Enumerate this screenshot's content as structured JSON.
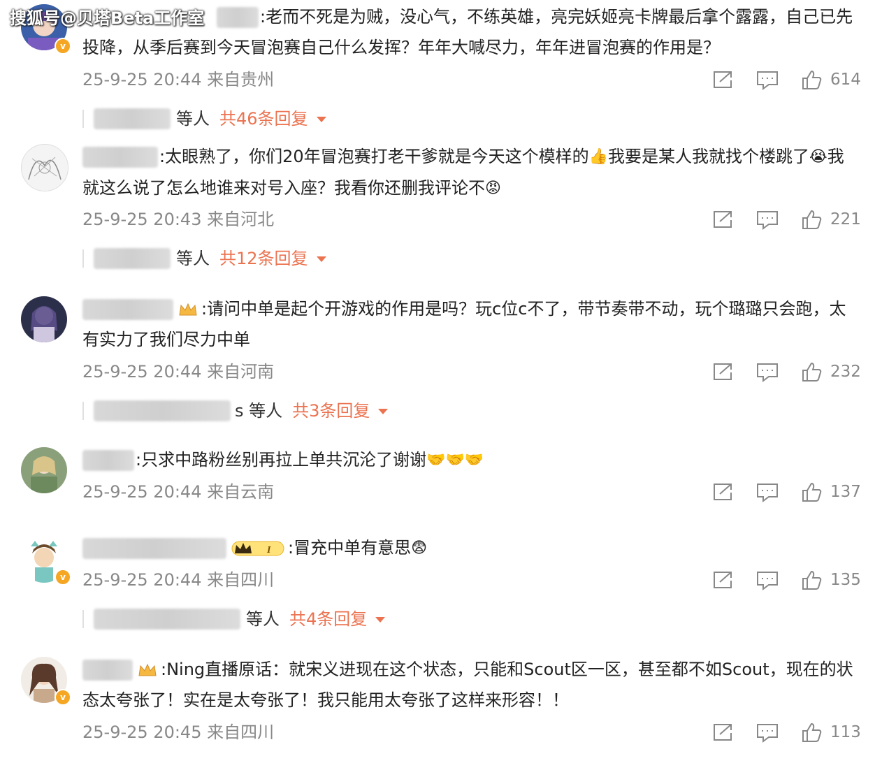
{
  "watermark": "搜狐号@贝塔Beta工作室",
  "colors": {
    "reply_accent": "#eb7350",
    "meta": "#888888",
    "badge": "#f5a623"
  },
  "icons": {
    "share": "share-icon",
    "comment": "comment-icon",
    "like": "like-icon"
  },
  "comments": [
    {
      "text": ":老而不死是为贼，没心气，不练英雄，亮完妖姬亮卡牌最后拿个露露，自己已先投降，从季后赛到今天冒泡赛自己什么发挥？年年大喊尽力，年年进冒泡赛的作用是？",
      "time": "25-9-25 20:44",
      "location": "来自贵州",
      "likes": "614",
      "replies": {
        "who": "等人",
        "count": "共46条回复"
      }
    },
    {
      "text_a": ":太眼熟了，你们20年冒泡赛打老干爹就是今天这个模样的",
      "text_b": "我要是某人我就找个楼跳了",
      "text_c": "我就这么说了怎么地谁来对号入座？我看你还删我评论不",
      "time": "25-9-25 20:43",
      "location": "来自河北",
      "likes": "221",
      "replies": {
        "who": "等人",
        "count": "共12条回复"
      }
    },
    {
      "text": ":请问中单是起个开游戏的作用是吗？玩c位c不了，带节奏带不动，玩个璐璐只会跑，太有实力了我们尽力中单",
      "time": "25-9-25 20:44",
      "location": "来自河南",
      "likes": "232",
      "replies": {
        "who": "s 等人",
        "count": "共3条回复"
      }
    },
    {
      "text": ":只求中路粉丝别再拉上单共沉沦了谢谢",
      "time": "25-9-25 20:44",
      "location": "来自云南",
      "likes": "137"
    },
    {
      "text": ":冒充中单有意思",
      "time": "25-9-25 20:44",
      "location": "来自四川",
      "likes": "135",
      "replies": {
        "who": "等人",
        "count": "共4条回复"
      }
    },
    {
      "text": ":Ning直播原话：就宋义进现在这个状态，只能和Scout区一区，甚至都不如Scout，现在的状态太夸张了！实在是太夸张了！我只能用太夸张了这样来形容！！",
      "time": "25-9-25 20:45",
      "location": "来自四川",
      "likes": "113"
    }
  ]
}
